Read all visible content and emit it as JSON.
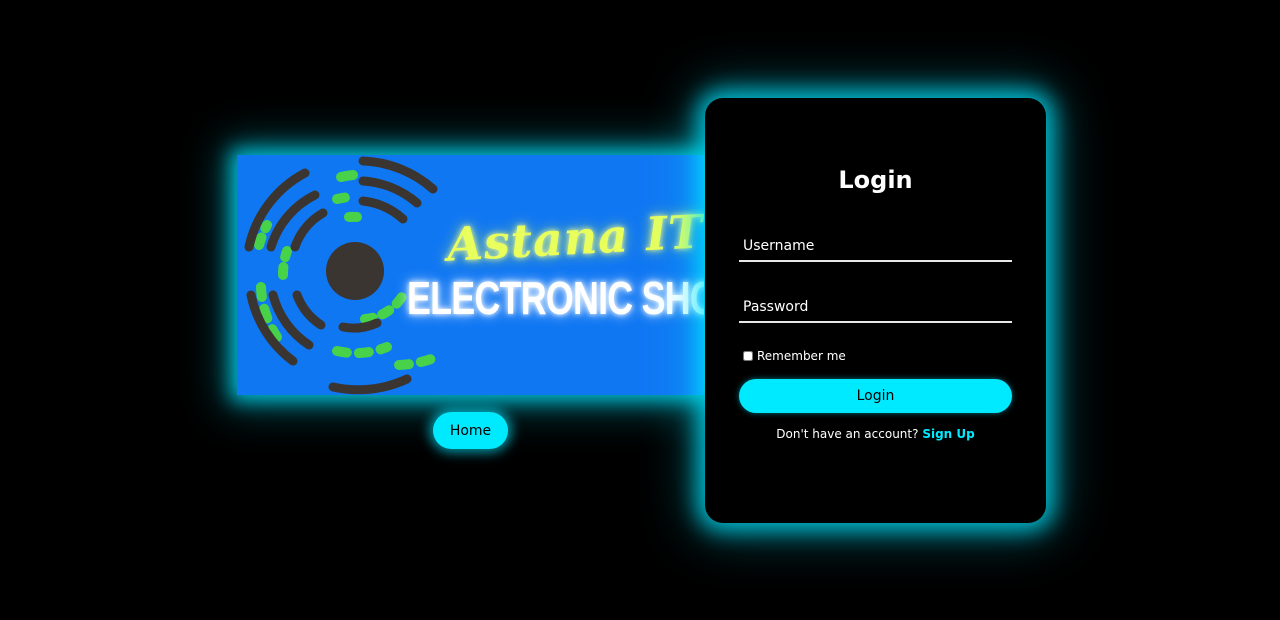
{
  "banner": {
    "line1": "Astana IT",
    "line2": "ELECTRONIC SHOP",
    "background": "#1077f3",
    "glow_color": "#00e5ff"
  },
  "nav": {
    "home_label": "Home"
  },
  "login": {
    "title": "Login",
    "username_placeholder": "Username",
    "password_placeholder": "Password",
    "remember_label": "Remember me",
    "remember_checked": false,
    "submit_label": "Login",
    "signup_prompt": "Don't have an account?",
    "signup_link": "Sign Up",
    "accent": "#00eaff"
  }
}
